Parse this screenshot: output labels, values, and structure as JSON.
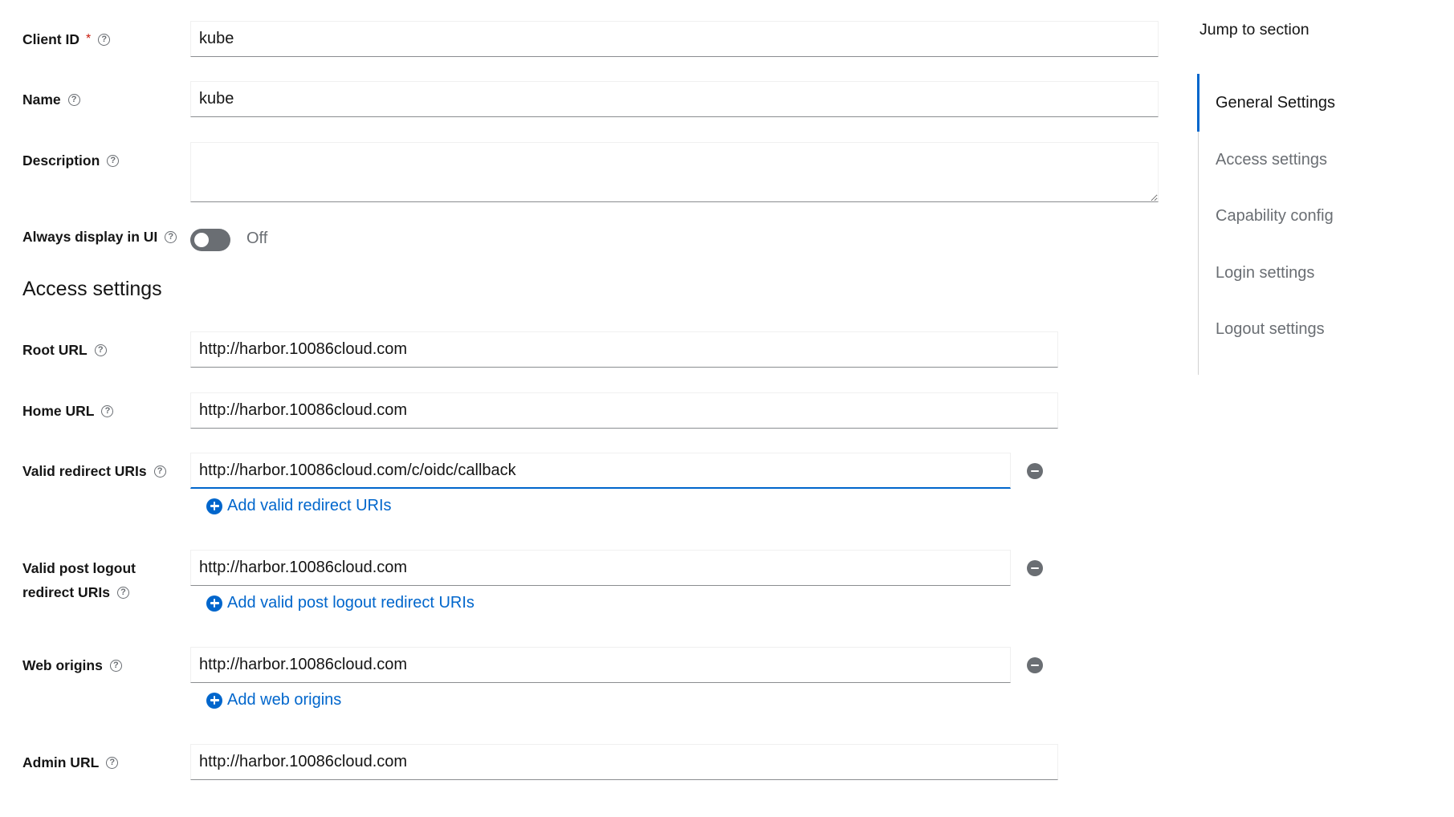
{
  "general": {
    "client_id": {
      "label": "Client ID",
      "required_mark": "*",
      "value": "kube"
    },
    "name": {
      "label": "Name",
      "value": "kube"
    },
    "description": {
      "label": "Description",
      "value": ""
    },
    "always_display": {
      "label": "Always display in UI",
      "state_text": "Off"
    }
  },
  "access": {
    "title": "Access settings",
    "root_url": {
      "label": "Root URL",
      "value": "http://harbor.10086cloud.com"
    },
    "home_url": {
      "label": "Home URL",
      "value": "http://harbor.10086cloud.com"
    },
    "redirect": {
      "label": "Valid redirect URIs",
      "value": "http://harbor.10086cloud.com/c/oidc/callback",
      "add_label": "Add valid redirect URIs"
    },
    "post_logout": {
      "label_line1": "Valid post logout",
      "label_line2": "redirect URIs",
      "value": "http://harbor.10086cloud.com",
      "add_label": "Add valid post logout redirect URIs"
    },
    "web_origins": {
      "label": "Web origins",
      "value": "http://harbor.10086cloud.com",
      "add_label": "Add web origins"
    },
    "admin_url": {
      "label": "Admin URL",
      "value": "http://harbor.10086cloud.com"
    }
  },
  "jump": {
    "title": "Jump to section",
    "items": [
      {
        "label": "General Settings"
      },
      {
        "label": "Access settings"
      },
      {
        "label": "Capability config"
      },
      {
        "label": "Login settings"
      },
      {
        "label": "Logout settings"
      }
    ]
  },
  "colors": {
    "link": "#0066cc",
    "required": "#c9190b",
    "toggle_off": "#6a6e73"
  }
}
